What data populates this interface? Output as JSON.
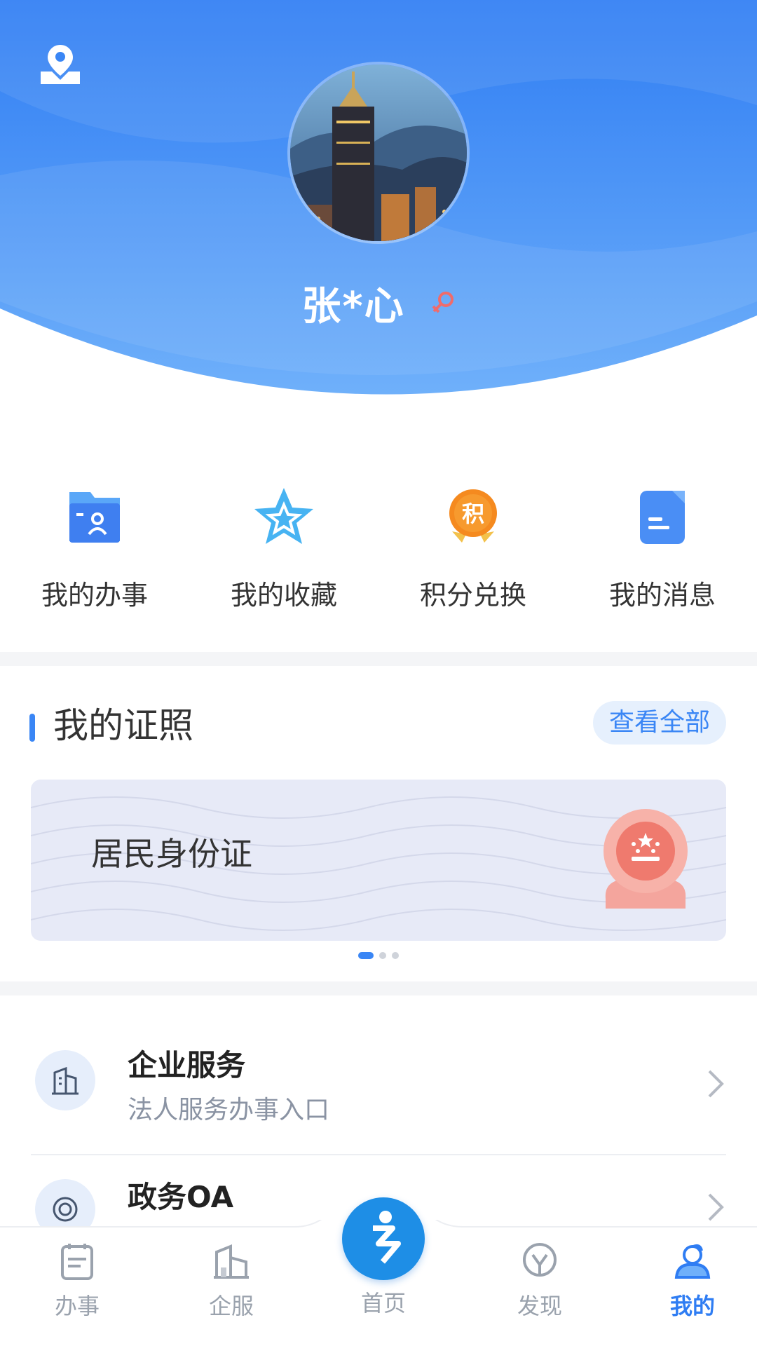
{
  "header": {
    "user_name": "张*心",
    "icons": {
      "location": "location-pin-icon",
      "gender": "female-symbol-icon"
    },
    "colors": {
      "primary": "#2f7df3",
      "light": "#6fb0fa"
    }
  },
  "quick_actions": [
    {
      "label": "我的办事",
      "icon": "folder-person-icon"
    },
    {
      "label": "我的收藏",
      "icon": "star-icon"
    },
    {
      "label": "积分兑换",
      "icon": "points-medal-icon",
      "badge_char": "积"
    },
    {
      "label": "我的消息",
      "icon": "message-document-icon"
    }
  ],
  "licenses": {
    "title": "我的证照",
    "view_all": "查看全部",
    "cards": [
      {
        "title": "居民身份证",
        "icon": "national-emblem-icon"
      }
    ],
    "pager": {
      "count": 3,
      "active": 0
    }
  },
  "services": [
    {
      "title": "企业服务",
      "subtitle": "法人服务办事入口",
      "icon": "building-icon"
    },
    {
      "title": "政务OA",
      "subtitle": "",
      "icon": "oa-icon"
    }
  ],
  "nav": {
    "items": [
      {
        "label": "办事",
        "icon": "clipboard-icon"
      },
      {
        "label": "企服",
        "icon": "buildings-icon"
      },
      {
        "label": "首页",
        "icon": "home-logo-icon"
      },
      {
        "label": "发现",
        "icon": "discover-icon"
      },
      {
        "label": "我的",
        "icon": "user-icon"
      }
    ],
    "active": "我的"
  }
}
